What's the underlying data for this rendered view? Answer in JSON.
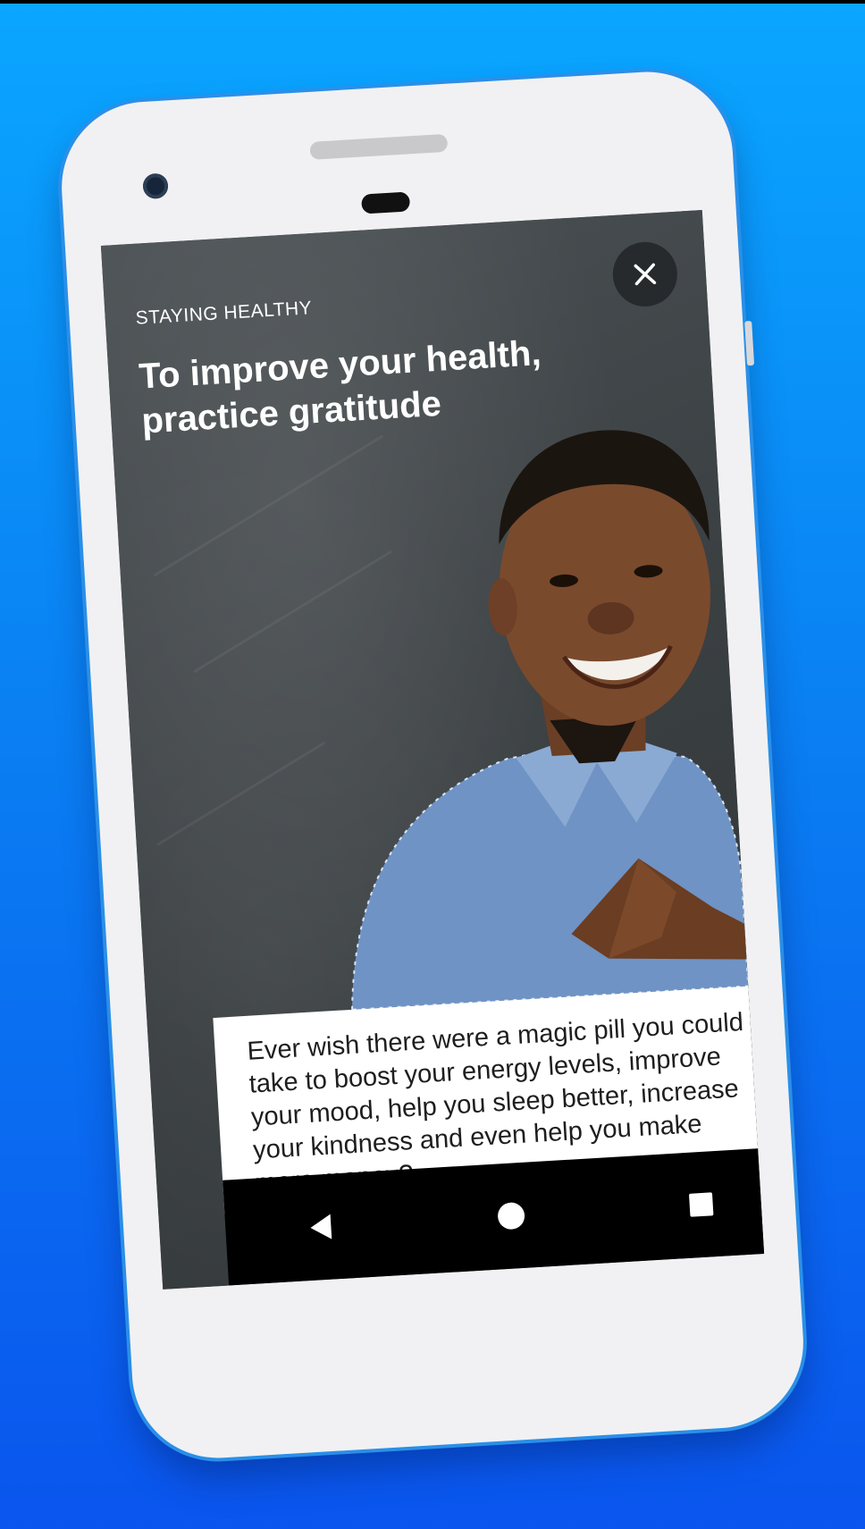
{
  "colors": {
    "background_top": "#0aa6ff",
    "background_bottom": "#0a55ee",
    "phone_body": "#f1f1f3",
    "close_button": "#262a2c",
    "nav_bar": "#000000"
  },
  "article": {
    "category": "STAYING HEALTHY",
    "title": "To improve your health, practice gratitude",
    "body": "Ever wish there were a magic pill you could take to boost your energy levels, improve your mood, help you sleep better, increase your kindness and even help you make more money?"
  },
  "icons": {
    "close": "close-icon",
    "back": "back-triangle-icon",
    "home": "home-circle-icon",
    "recents": "recents-square-icon"
  }
}
